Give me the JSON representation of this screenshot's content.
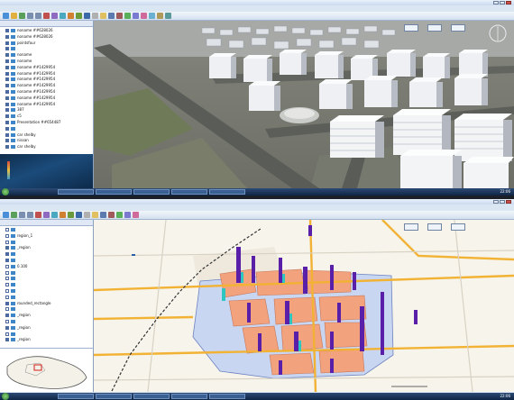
{
  "top_window": {
    "layer_tree": [
      {
        "label": "noname ##628026",
        "checked": true
      },
      {
        "label": "noname ##628026",
        "checked": true
      },
      {
        "label": "pointsfour",
        "checked": true
      },
      {
        "label": "",
        "checked": true
      },
      {
        "label": "noname",
        "checked": true
      },
      {
        "label": "noname",
        "checked": true
      },
      {
        "label": "noname ##1429954",
        "checked": true
      },
      {
        "label": "noname ##1429954",
        "checked": true
      },
      {
        "label": "noname ##1429954",
        "checked": true
      },
      {
        "label": "noname ##1429954",
        "checked": true
      },
      {
        "label": "noname ##1429954",
        "checked": true
      },
      {
        "label": "noname ##1429954",
        "checked": true
      },
      {
        "label": "noname ##1429954",
        "checked": true
      },
      {
        "label": "387",
        "checked": true
      },
      {
        "label": "c5",
        "checked": true
      },
      {
        "label": "Presentation ##654487",
        "checked": true
      },
      {
        "label": "",
        "checked": true
      },
      {
        "label": "car shelby",
        "checked": true
      },
      {
        "label": "nissan",
        "checked": true
      },
      {
        "label": "car shelby",
        "checked": true
      }
    ],
    "taskbar": {
      "clock": "22:06"
    }
  },
  "bottom_window": {
    "layer_tree": [
      {
        "label": "",
        "checked": false
      },
      {
        "label": "region_1",
        "checked": false
      },
      {
        "label": "",
        "checked": false
      },
      {
        "label": "_region",
        "checked": true
      },
      {
        "label": "",
        "checked": true
      },
      {
        "label": "",
        "checked": true
      },
      {
        "label": "0.100",
        "checked": false
      },
      {
        "label": "",
        "checked": false
      },
      {
        "label": "",
        "checked": false
      },
      {
        "label": "",
        "checked": false
      },
      {
        "label": "",
        "checked": false
      },
      {
        "label": "",
        "checked": false
      },
      {
        "label": "rounded_rectangle",
        "checked": true
      },
      {
        "label": "",
        "checked": false
      },
      {
        "label": "_region",
        "checked": true
      },
      {
        "label": "",
        "checked": false
      },
      {
        "label": "_region",
        "checked": true
      },
      {
        "label": "",
        "checked": false
      },
      {
        "label": "_region",
        "checked": true
      }
    ],
    "taskbar": {
      "clock": "22:06"
    }
  },
  "colors": {
    "accent": "#2b5fa6",
    "district_fill": "#f0a07a",
    "bar_purple": "#5a1fa8",
    "bar_cyan": "#2ec6c0",
    "road_orange": "#f2b234"
  }
}
